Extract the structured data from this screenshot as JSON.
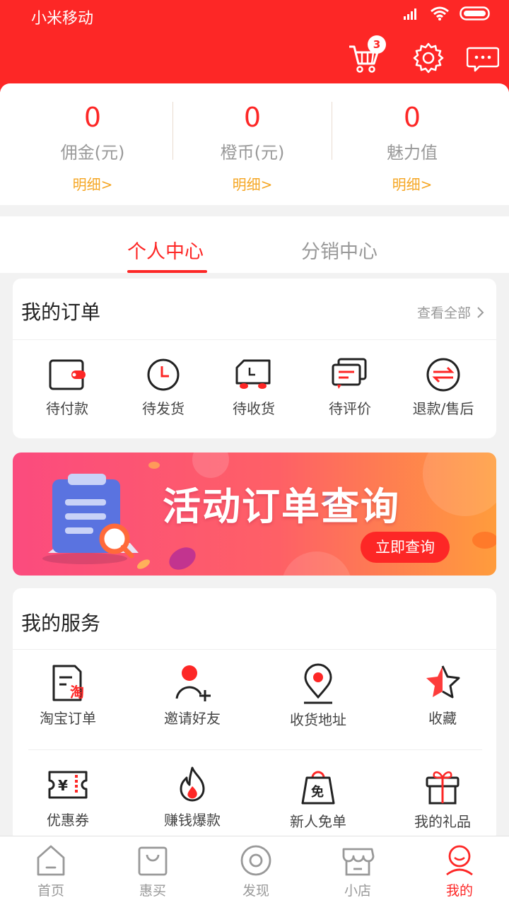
{
  "status_bar": {
    "carrier": "小米移动"
  },
  "header": {
    "cart_badge": "3"
  },
  "stats": [
    {
      "value": "0",
      "label": "佣金(元)",
      "detail": "明细>"
    },
    {
      "value": "0",
      "label": "橙币(元)",
      "detail": "明细>"
    },
    {
      "value": "0",
      "label": "魅力值",
      "detail": "明细>"
    }
  ],
  "tabs": [
    {
      "label": "个人中心",
      "active": true
    },
    {
      "label": "分销中心",
      "active": false
    }
  ],
  "orders": {
    "title": "我的订单",
    "view_all": "查看全部",
    "items": [
      {
        "label": "待付款",
        "icon": "wallet-icon"
      },
      {
        "label": "待发货",
        "icon": "clock-icon"
      },
      {
        "label": "待收货",
        "icon": "truck-icon"
      },
      {
        "label": "待评价",
        "icon": "comment-icon"
      },
      {
        "label": "退款/售后",
        "icon": "refund-icon"
      }
    ]
  },
  "banner": {
    "title": "活动订单查询",
    "button": "立即查询"
  },
  "services": {
    "title": "我的服务",
    "items": [
      {
        "label": "淘宝订单",
        "icon": "taobao-order-icon"
      },
      {
        "label": "邀请好友",
        "icon": "invite-friend-icon"
      },
      {
        "label": "收货地址",
        "icon": "location-pin-icon"
      },
      {
        "label": "收藏",
        "icon": "star-icon"
      },
      {
        "label": "优惠券",
        "icon": "coupon-icon"
      },
      {
        "label": "赚钱爆款",
        "icon": "flame-icon"
      },
      {
        "label": "新人免单",
        "icon": "free-bag-icon"
      },
      {
        "label": "我的礼品",
        "icon": "gift-icon"
      }
    ]
  },
  "bottom_nav": [
    {
      "label": "首页",
      "icon": "home-icon",
      "active": false
    },
    {
      "label": "惠买",
      "icon": "shopping-bag-icon",
      "active": false
    },
    {
      "label": "发现",
      "icon": "discover-icon",
      "active": false
    },
    {
      "label": "小店",
      "icon": "shop-icon",
      "active": false
    },
    {
      "label": "我的",
      "icon": "profile-icon",
      "active": true
    }
  ],
  "colors": {
    "brand_red": "#fd2726",
    "accent_orange": "#f5a623",
    "muted_text": "#999999"
  }
}
